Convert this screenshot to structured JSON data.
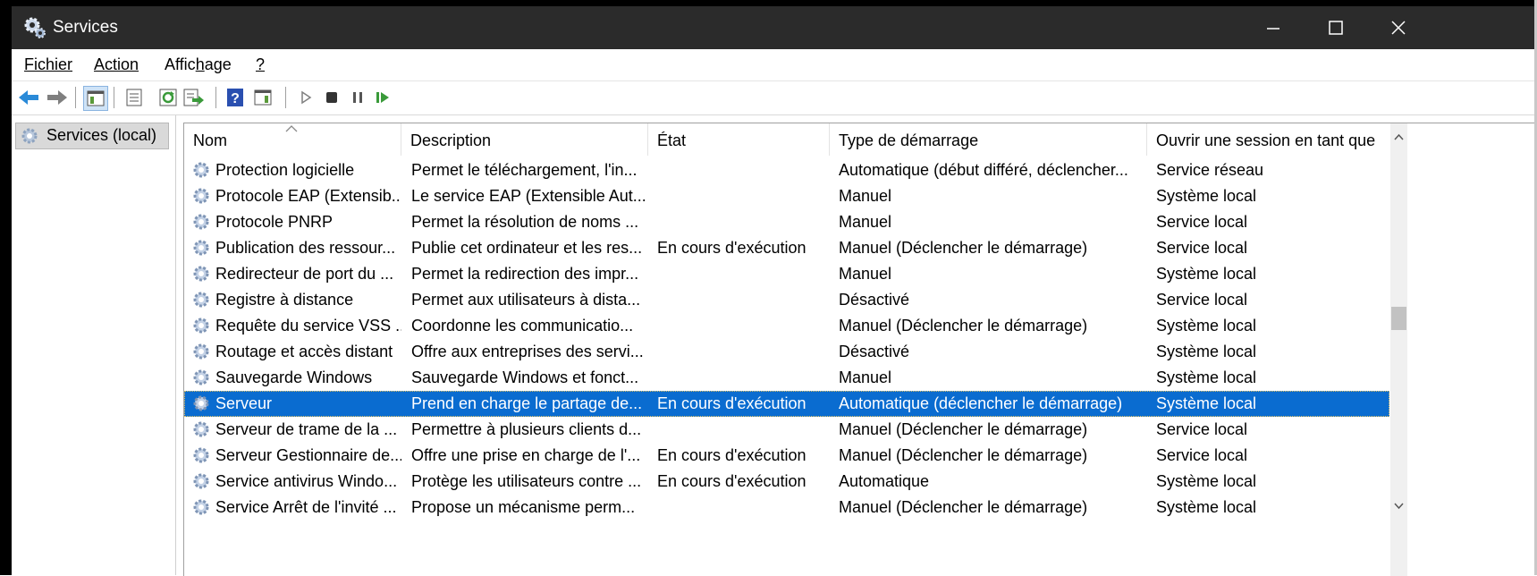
{
  "window": {
    "title": "Services",
    "minimize_glyph": "—",
    "maximize_glyph": "☐",
    "close_glyph": "✕"
  },
  "menu": {
    "items": [
      {
        "id": "fichier",
        "label": "Fichier"
      },
      {
        "id": "action",
        "label": "Action"
      },
      {
        "id": "affichage",
        "label": "Affichage"
      },
      {
        "id": "help",
        "label": "?"
      }
    ]
  },
  "tree": {
    "root_label": "Services (local)"
  },
  "columns": [
    {
      "key": "name",
      "label": "Nom"
    },
    {
      "key": "description",
      "label": "Description"
    },
    {
      "key": "state",
      "label": "État"
    },
    {
      "key": "startup",
      "label": "Type de démarrage"
    },
    {
      "key": "logon",
      "label": "Ouvrir une session en tant que"
    }
  ],
  "rows": [
    {
      "name": "Protection logicielle",
      "description": "Permet le téléchargement, l'in...",
      "state": "",
      "startup": "Automatique (début différé, déclencher...",
      "logon": "Service réseau"
    },
    {
      "name": "Protocole EAP (Extensib...",
      "description": "Le service EAP (Extensible Aut...",
      "state": "",
      "startup": "Manuel",
      "logon": "Système local"
    },
    {
      "name": "Protocole PNRP",
      "description": "Permet la résolution de noms ...",
      "state": "",
      "startup": "Manuel",
      "logon": "Service local"
    },
    {
      "name": "Publication des ressour...",
      "description": "Publie cet ordinateur et les res...",
      "state": "En cours d'exécution",
      "startup": "Manuel (Déclencher le démarrage)",
      "logon": "Service local"
    },
    {
      "name": "Redirecteur de port du ...",
      "description": "Permet la redirection des impr...",
      "state": "",
      "startup": "Manuel",
      "logon": "Système local"
    },
    {
      "name": "Registre à distance",
      "description": "Permet aux utilisateurs à dista...",
      "state": "",
      "startup": "Désactivé",
      "logon": "Service local"
    },
    {
      "name": "Requête du service VSS ...",
      "description": "Coordonne les communicatio...",
      "state": "",
      "startup": "Manuel (Déclencher le démarrage)",
      "logon": "Système local"
    },
    {
      "name": "Routage et accès distant",
      "description": "Offre aux entreprises des servi...",
      "state": "",
      "startup": "Désactivé",
      "logon": "Système local"
    },
    {
      "name": "Sauvegarde Windows",
      "description": "Sauvegarde Windows et fonct...",
      "state": "",
      "startup": "Manuel",
      "logon": "Système local"
    },
    {
      "name": "Serveur",
      "description": "Prend en charge le partage de...",
      "state": "En cours d'exécution",
      "startup": "Automatique (déclencher le démarrage)",
      "logon": "Système local",
      "selected": true
    },
    {
      "name": "Serveur de trame de la ...",
      "description": "Permettre à plusieurs clients d...",
      "state": "",
      "startup": "Manuel (Déclencher le démarrage)",
      "logon": "Service local"
    },
    {
      "name": "Serveur Gestionnaire de...",
      "description": "Offre une prise en charge de l'...",
      "state": "En cours d'exécution",
      "startup": "Manuel (Déclencher le démarrage)",
      "logon": "Service local"
    },
    {
      "name": "Service antivirus Windo...",
      "description": "Protège les utilisateurs contre ...",
      "state": "En cours d'exécution",
      "startup": "Automatique",
      "logon": "Système local"
    },
    {
      "name": "Service Arrêt de l'invité ...",
      "description": "Propose un mécanisme perm...",
      "state": "",
      "startup": "Manuel (Déclencher le démarrage)",
      "logon": "Système local"
    }
  ],
  "colors": {
    "titlebar": "#2b2b2b",
    "selection": "#0a6cd0",
    "tree_selected": "#d9d9d9"
  }
}
